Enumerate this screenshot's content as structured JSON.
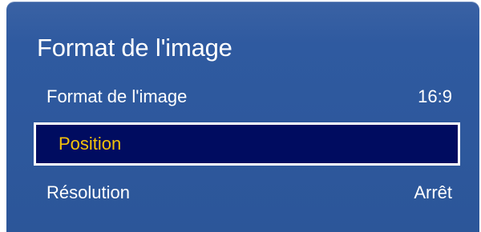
{
  "menu": {
    "title": "Format de l'image",
    "items": [
      {
        "label": "Format de l'image",
        "value": "16:9"
      },
      {
        "label": "Position",
        "value": ""
      },
      {
        "label": "Résolution",
        "value": "Arrêt"
      }
    ],
    "selected_index": 1
  },
  "colors": {
    "panel_background": "#2e589c",
    "highlight_background": "#000c60",
    "highlight_text": "#f4c20a",
    "text": "#ffffff",
    "highlight_border": "#ffffff"
  }
}
